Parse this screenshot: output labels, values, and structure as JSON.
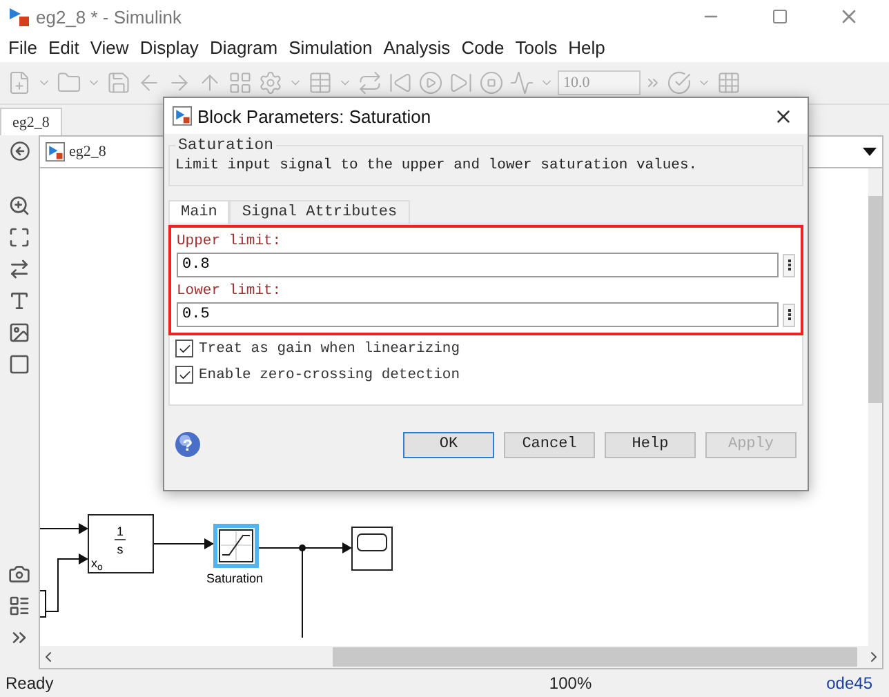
{
  "window": {
    "title": "eg2_8 * - Simulink"
  },
  "menu": [
    "File",
    "Edit",
    "View",
    "Display",
    "Diagram",
    "Simulation",
    "Analysis",
    "Code",
    "Tools",
    "Help"
  ],
  "toolbar": {
    "stop_time": "10.0"
  },
  "model_tabs": [
    {
      "label": "eg2_8",
      "selected": true
    }
  ],
  "breadcrumb": "eg2_8",
  "diagram": {
    "blocks": [
      {
        "kind": "integrator",
        "numerator": "1",
        "denominator": "s",
        "port_label": "x$_{o}$",
        "selected": false
      },
      {
        "kind": "saturation",
        "label": "Saturation",
        "selected": true
      },
      {
        "kind": "scope",
        "selected": false
      }
    ]
  },
  "status_bar": {
    "status": "Ready",
    "zoom": "100%",
    "solver": "ode45"
  },
  "dialog": {
    "title": "Block Parameters: Saturation",
    "group": "Saturation",
    "description": "Limit input signal to the upper and lower saturation values.",
    "tabs": [
      {
        "label": "Main",
        "selected": true
      },
      {
        "label": "Signal Attributes",
        "selected": false
      }
    ],
    "highlighted": true,
    "help_glyph": "?",
    "parameters": [
      {
        "label": "Upper limit:",
        "value": "0.8"
      },
      {
        "label": "Lower limit:",
        "value": "0.5"
      }
    ],
    "checkboxes": [
      {
        "label": "Treat as gain when linearizing",
        "checked": true
      },
      {
        "label": "Enable zero-crossing detection",
        "checked": true
      }
    ],
    "buttons": [
      {
        "label": "OK",
        "default": true,
        "disabled": false
      },
      {
        "label": "Cancel",
        "default": false,
        "disabled": false
      },
      {
        "label": "Help",
        "default": false,
        "disabled": false
      },
      {
        "label": "Apply",
        "default": false,
        "disabled": true
      }
    ]
  }
}
